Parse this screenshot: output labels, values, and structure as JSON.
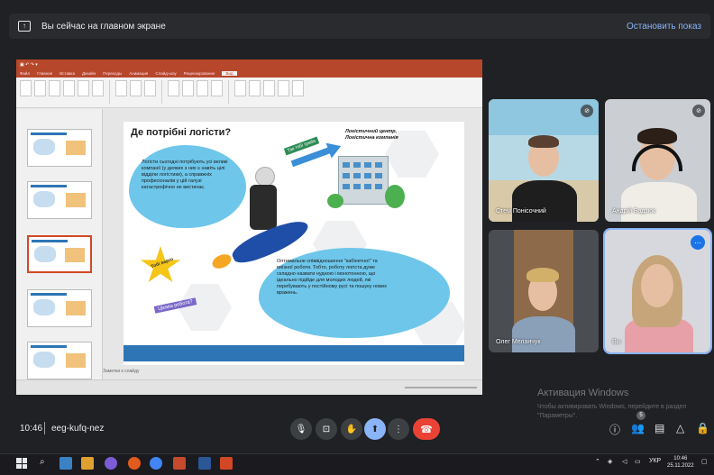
{
  "banner": {
    "text": "Вы сейчас на главном экране",
    "stop_label": "Остановить показ",
    "icon": "present-to-all-icon"
  },
  "ppt": {
    "tabs": [
      "Файл",
      "Главная",
      "Вставка",
      "Дизайн",
      "Переходы",
      "Анимация",
      "Слайд-шоу",
      "Рецензирование",
      "Вид"
    ],
    "notes_placeholder": "Заметки к слайду",
    "slide": {
      "title": "Де потрібні логісти?",
      "cloud1": "Логісти сьогодні потрібують усі великі компанії (у деяких з них є навіть цілі відділи логістики), а справжніх професіоналів у цій галузі катастрофічно не вистачає.",
      "caption": "Логістичний центр, Логістична компанія",
      "green_tag": "Так тобі треба",
      "cloud2": "Оптимальне співвідношення \"кабінетної\" та виїзної роботи. Тобто, роботу логіста дуже складно назвати нудною і монотонною, що ідеально підійде для молодих людей, які перебувають у постійному русі та пошуку нових вражень.",
      "star_label": "Тобі варто",
      "purple_tag": "Цікава робота?"
    }
  },
  "participants": [
    {
      "name": "Стем Понісочний",
      "icon": "mic-off-icon"
    },
    {
      "name": "Андрій Бадзюк",
      "icon": "mic-off-icon"
    },
    {
      "name": "Олег Меланчук",
      "icon": "mic-off-icon"
    },
    {
      "name": "Вы",
      "icon": "more-options-icon"
    }
  ],
  "watermark": {
    "title": "Активация Windows",
    "subtitle": "Чтобы активировать Windows, перейдите в раздел \"Параметры\"."
  },
  "meeting": {
    "time": "10:46",
    "code": "eeg-kufq-nez",
    "participants_badge": "5"
  },
  "controls": [
    "mic-icon",
    "captions-icon",
    "raise-hand-icon",
    "present-icon",
    "more-icon",
    "end-call-icon"
  ],
  "taskbar": {
    "lang": "УКР",
    "time": "10:46",
    "date": "25.11.2022"
  },
  "colors": {
    "accent": "#8ab4f8",
    "end_call": "#ea4335",
    "ppt": "#b7472a",
    "cloud": "#6ec6ea"
  }
}
